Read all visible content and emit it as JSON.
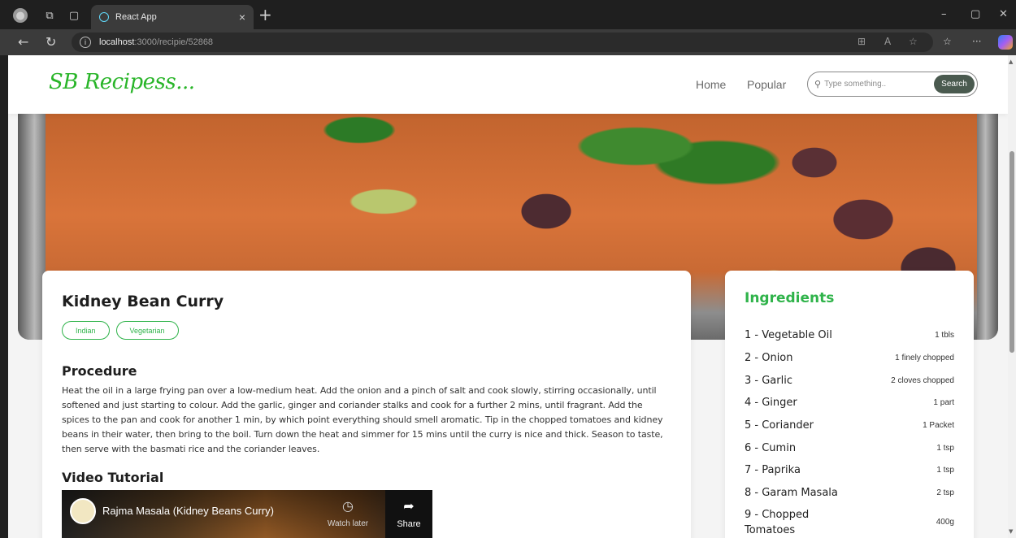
{
  "browser": {
    "tab_title": "React App",
    "url_host": "localhost",
    "url_path": ":3000/recipie/52868",
    "tab_close": "×",
    "new_tab": "+"
  },
  "header": {
    "logo": "SB Recipess...",
    "nav": [
      "Home",
      "Popular"
    ],
    "search_placeholder": "Type something..",
    "search_button": "Search"
  },
  "recipe": {
    "title": "Kidney Bean Curry",
    "tags": [
      "Indian",
      "Vegetarian"
    ],
    "procedure_heading": "Procedure",
    "procedure": "Heat the oil in a large frying pan over a low-medium heat. Add the onion and a pinch of salt and cook slowly, stirring occasionally, until softened and just starting to colour. Add the garlic, ginger and coriander stalks and cook for a further 2 mins, until fragrant. Add the spices to the pan and cook for another 1 min, by which point everything should smell aromatic. Tip in the chopped tomatoes and kidney beans in their water, then bring to the boil. Turn down the heat and simmer for 15 mins until the curry is nice and thick. Season to taste, then serve with the basmati rice and the coriander leaves.",
    "video_heading": "Video Tutorial",
    "video": {
      "title": "Rajma Masala (Kidney Beans Curry)",
      "watch_later": "Watch later",
      "share": "Share"
    }
  },
  "ingredients": {
    "heading": "Ingredients",
    "items": [
      {
        "name": "1 - Vegetable Oil",
        "qty": "1 tbls"
      },
      {
        "name": "2 - Onion",
        "qty": "1 finely chopped"
      },
      {
        "name": "3 - Garlic",
        "qty": "2 cloves chopped"
      },
      {
        "name": "4 - Ginger",
        "qty": "1 part"
      },
      {
        "name": "5 - Coriander",
        "qty": "1 Packet"
      },
      {
        "name": "6 - Cumin",
        "qty": "1 tsp"
      },
      {
        "name": "7 - Paprika",
        "qty": "1 tsp"
      },
      {
        "name": "8 - Garam Masala",
        "qty": "2 tsp"
      },
      {
        "name": "9 - Chopped Tomatoes",
        "qty": "400g"
      }
    ]
  },
  "colors": {
    "brand_green": "#2fb34a",
    "search_button": "#4a5a4f"
  }
}
